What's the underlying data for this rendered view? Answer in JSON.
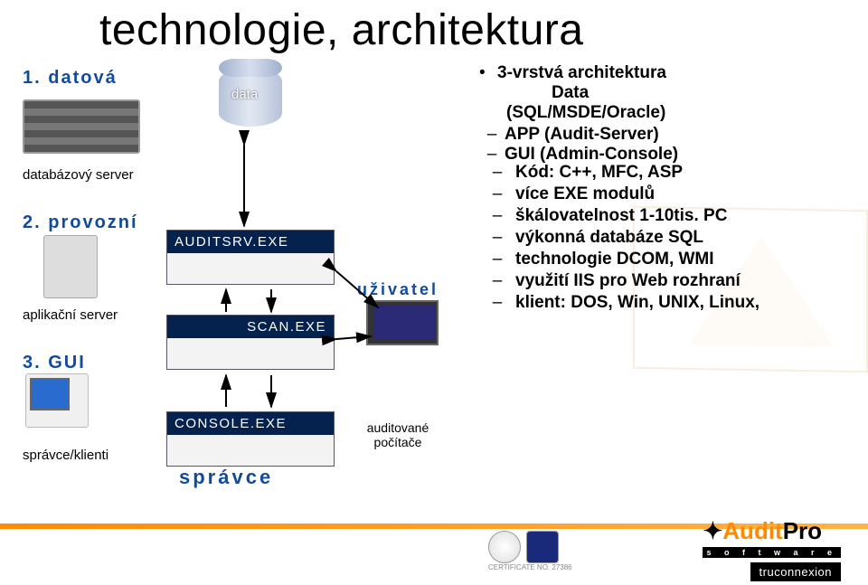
{
  "title": "technologie, architektura",
  "tiers": {
    "t1": "1. datová",
    "t2": "2. provozní",
    "t3": "3. GUI",
    "db_server": "databázový server",
    "app_server": "aplikační server",
    "admin_clients": "správce/klienti"
  },
  "center": {
    "cylinder": "data",
    "audit_exe": "AUDITSRV.EXE",
    "scan_exe": "SCAN.EXE",
    "console_exe": "CONSOLE.EXE",
    "admin": "správce"
  },
  "middle": {
    "user": "uživatel",
    "audited": "auditované počítače"
  },
  "right_lead_bullet": "3-vrstvá architektura",
  "right_lead_sub1": "Data",
  "right_lead_sub2": "(SQL/MSDE/Oracle)",
  "right_sub_items": [
    "APP (Audit-Server)",
    "GUI (Admin-Console)"
  ],
  "right_items": [
    "Kód: C++, MFC, ASP",
    "více EXE modulů",
    "škálovatelnost 1-10tis. PC",
    "výkonná databáze SQL",
    "technologie DCOM, WMI",
    "využití IIS pro Web rozhraní",
    "klient: DOS, Win, UNIX, Linux,"
  ],
  "footer": {
    "brand_main_a": "Audit",
    "brand_main_b": "Pro",
    "brand_soft": "s o f t w a r e",
    "brand_tru": "truconnexion",
    "cert": "CERTIFICATE NO. 27386"
  }
}
